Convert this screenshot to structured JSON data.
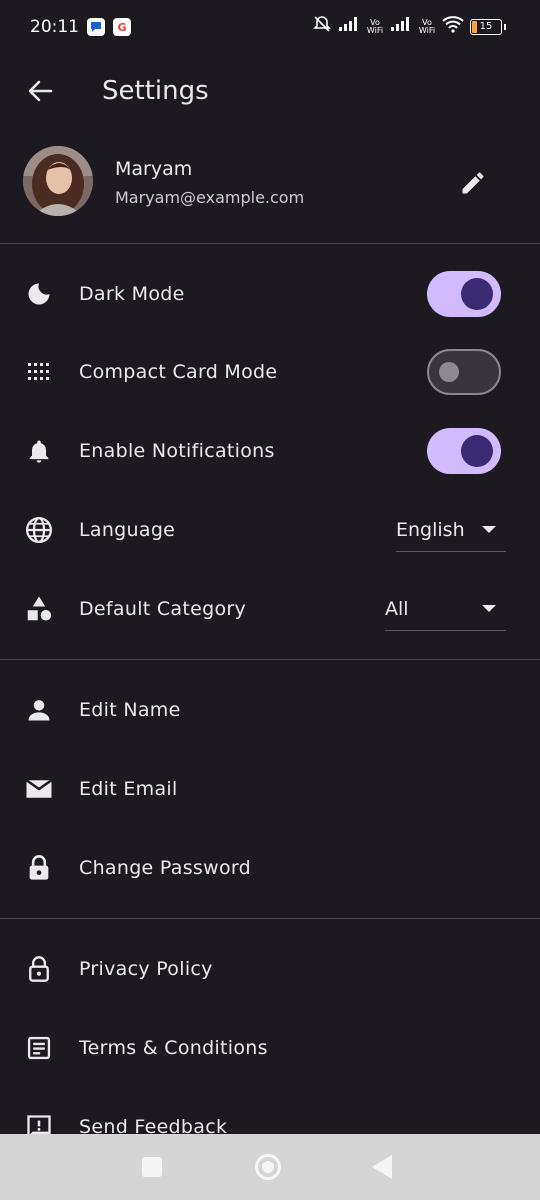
{
  "status_bar": {
    "time": "20:11",
    "app_icons": [
      "chat-bubble-icon",
      "google-icon"
    ],
    "vowifi_1": "Vo WiFi",
    "vowifi_2": "Vo WiFi",
    "battery": "15"
  },
  "appbar": {
    "title": "Settings"
  },
  "profile": {
    "name": "Maryam",
    "email": "Maryam@example.com"
  },
  "preferences": {
    "dark_mode": {
      "label": "Dark Mode",
      "enabled": true
    },
    "compact_card_mode": {
      "label": "Compact Card Mode",
      "enabled": false
    },
    "notifications": {
      "label": "Enable Notifications",
      "enabled": true
    },
    "language": {
      "label": "Language",
      "value": "English"
    },
    "default_category": {
      "label": "Default Category",
      "value": "All"
    }
  },
  "account": {
    "edit_name": "Edit Name",
    "edit_email": "Edit Email",
    "change_password": "Change Password"
  },
  "about": {
    "privacy_policy": "Privacy Policy",
    "terms": "Terms & Conditions",
    "feedback": "Send Feedback"
  },
  "colors": {
    "background": "#1c1a20",
    "toggle_on_track": "#d2bbfc",
    "toggle_on_knob": "#3b2a74",
    "toggle_off_track": "#38353d"
  }
}
